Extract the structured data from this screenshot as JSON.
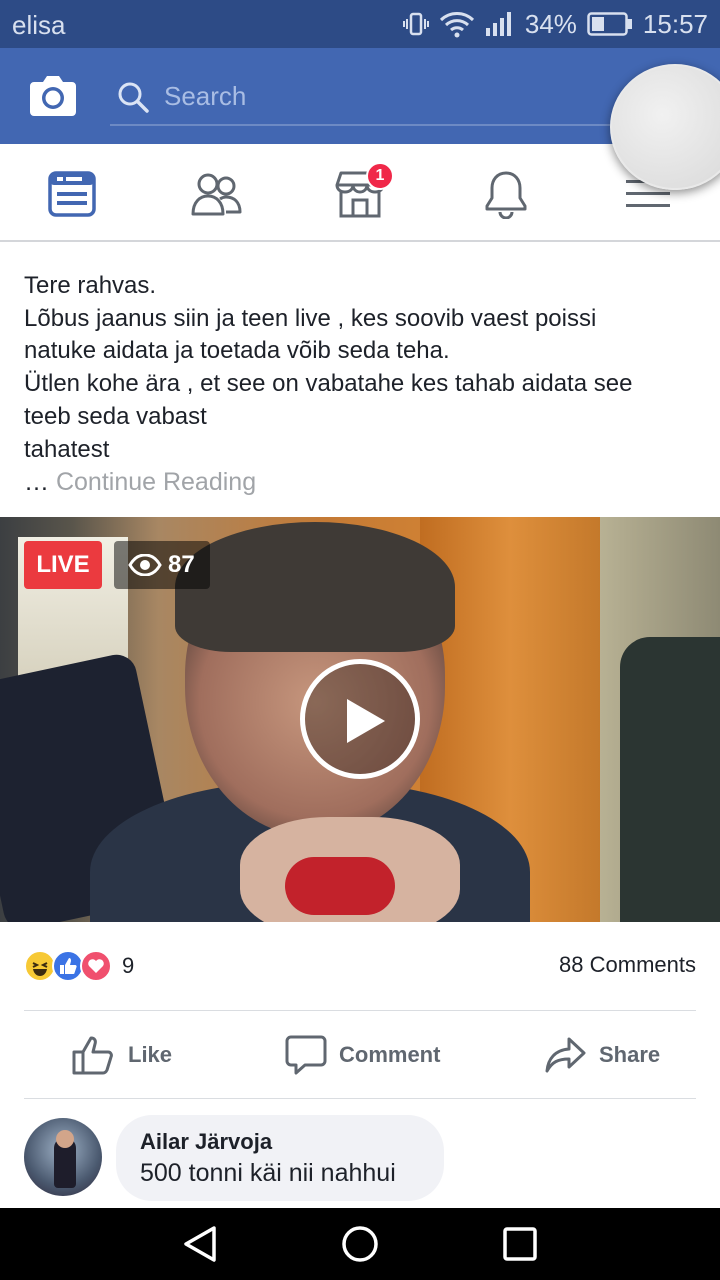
{
  "status_bar": {
    "carrier": "elisa",
    "battery": "34%",
    "time": "15:57"
  },
  "header": {
    "search_placeholder": "Search"
  },
  "nav": {
    "marketplace_badge": "1"
  },
  "post": {
    "text_lines": [
      "Tere rahvas.",
      "Lõbus jaanus siin ja teen live , kes soovib vaest poissi",
      "natuke aidata ja toetada võib seda teha.",
      "Ütlen kohe ära , et see on vabatahe kes tahab aidata see",
      "teeb seda vabast",
      "tahatest"
    ],
    "ellipsis": "…",
    "continue_reading": "Continue Reading"
  },
  "video": {
    "live_label": "LIVE",
    "viewers": "87"
  },
  "stats": {
    "reaction_count": "9",
    "comments": "88 Comments"
  },
  "actions": {
    "like": "Like",
    "comment": "Comment",
    "share": "Share"
  },
  "comment": {
    "author": "Ailar Järvoja",
    "text": "500 tonni käi nii nahhui"
  },
  "colors": {
    "header_blue": "#4267b2",
    "status_bar": "#2d4b86",
    "live_red": "#eb3a3f",
    "badge_red": "#f02849"
  }
}
